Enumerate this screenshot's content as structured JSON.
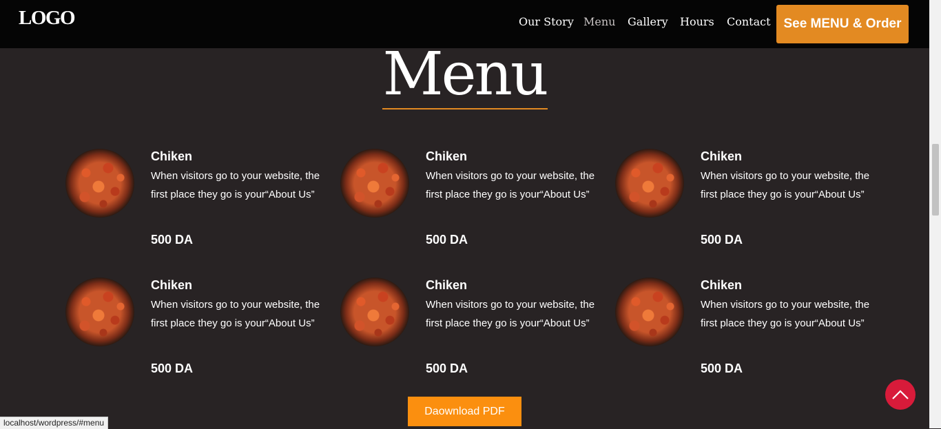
{
  "header": {
    "logo": "LOGO",
    "nav": [
      {
        "label": "Our Story",
        "active": false
      },
      {
        "label": "Menu",
        "active": true
      },
      {
        "label": "Gallery",
        "active": false
      },
      {
        "label": "Hours",
        "active": false
      },
      {
        "label": "Contact",
        "active": false
      }
    ],
    "cta_label": "See MENU & Order"
  },
  "section": {
    "title": "Menu"
  },
  "menu_items": [
    {
      "name": "Chiken",
      "description": "When visitors go to your website, the first place they go is your“About Us”",
      "price": "500 DA"
    },
    {
      "name": "Chiken",
      "description": "When visitors go to your website, the first place they go is your“About Us”",
      "price": "500 DA"
    },
    {
      "name": "Chiken",
      "description": "When visitors go to your website, the first place they go is your“About Us”",
      "price": "500 DA"
    },
    {
      "name": "Chiken",
      "description": "When visitors go to your website, the first place they go is your“About Us”",
      "price": "500 DA"
    },
    {
      "name": "Chiken",
      "description": "When visitors go to your website, the first place they go is your“About Us”",
      "price": "500 DA"
    },
    {
      "name": "Chiken",
      "description": "When visitors go to your website, the first place they go is your“About Us”",
      "price": "500 DA"
    }
  ],
  "download_label": "Daownload PDF",
  "status_url": "localhost/wordpress/#menu",
  "colors": {
    "background": "#282324",
    "header": "#050505",
    "accent": "#e38a22",
    "download_button": "#fb8f0f",
    "back_to_top": "#d81b3a"
  },
  "icons": {
    "back_to_top": "chevron-up-icon"
  }
}
